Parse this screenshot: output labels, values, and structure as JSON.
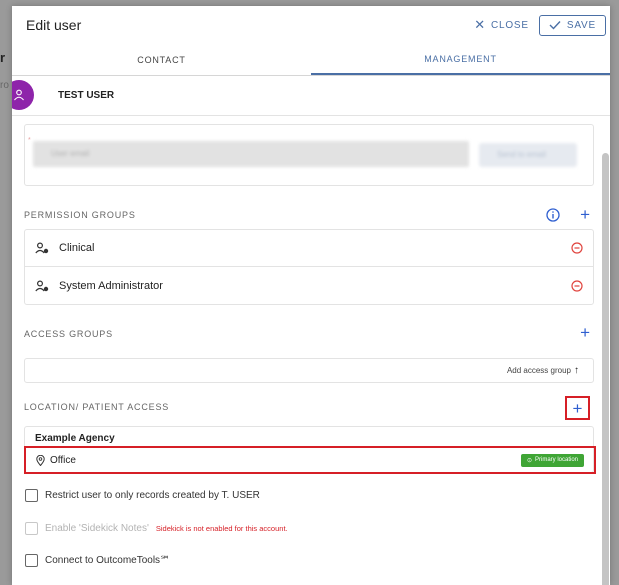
{
  "backdrop": {
    "fragment_letter": "r",
    "fragment_text": "ro"
  },
  "dialog": {
    "title": "Edit user",
    "close_label": "CLOSE",
    "save_label": "SAVE"
  },
  "tabs": [
    {
      "label": "CONTACT",
      "active": false
    },
    {
      "label": "MANAGEMENT",
      "active": true
    }
  ],
  "user": {
    "name": "TEST USER"
  },
  "email": {
    "placeholder": "User email",
    "button_label": "Send to email"
  },
  "permission_groups": {
    "title": "PERMISSION GROUPS",
    "items": [
      {
        "label": "Clinical"
      },
      {
        "label": "System Administrator"
      }
    ]
  },
  "access_groups": {
    "title": "ACCESS GROUPS",
    "add_label": "Add access group"
  },
  "location_access": {
    "title": "LOCATION/ PATIENT ACCESS",
    "agency": "Example Agency",
    "location": "Office",
    "badge": "Primary location"
  },
  "options": {
    "restrict": "Restrict user to only records created by T. USER",
    "sidekick": "Enable 'Sidekick Notes'",
    "sidekick_warning": "Sidekick is not enabled for this account.",
    "outcome": "Connect to OutcomeTools℠"
  },
  "colors": {
    "accent": "#4a6fa5",
    "plus_blue": "#2f5fd0",
    "avatar": "#8e24aa",
    "danger": "#d61f26",
    "badge_green": "#3fa535"
  }
}
